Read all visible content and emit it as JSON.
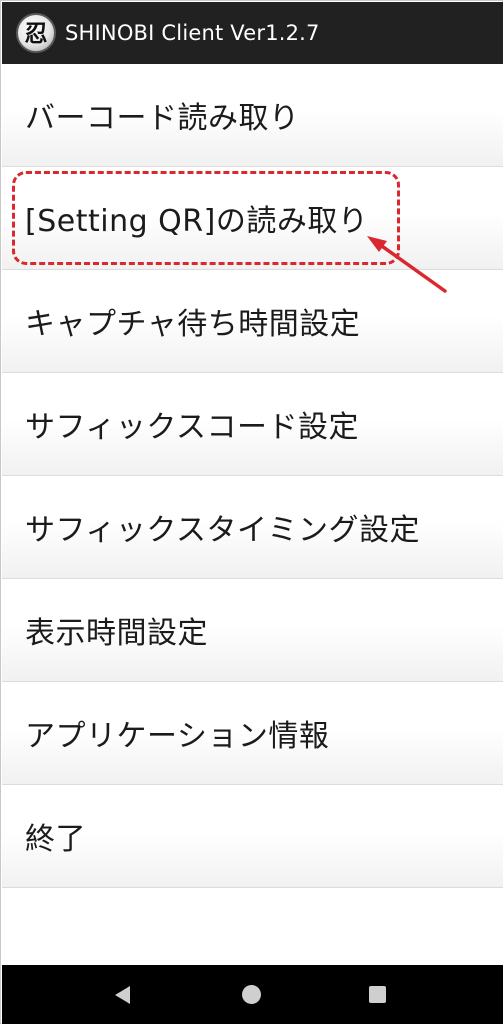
{
  "titlebar": {
    "icon_glyph": "忍",
    "icon_name": "shinobi-logo-icon",
    "title": "SHINOBI Client Ver1.2.7"
  },
  "menu": {
    "items": [
      {
        "label": "バーコード読み取り"
      },
      {
        "label": "[Setting QR]の読み取り"
      },
      {
        "label": "キャプチャ待ち時間設定"
      },
      {
        "label": "サフィックスコード設定"
      },
      {
        "label": "サフィックスタイミング設定"
      },
      {
        "label": "表示時間設定"
      },
      {
        "label": "アプリケーション情報"
      },
      {
        "label": "終了"
      }
    ]
  },
  "annotation": {
    "highlighted_item": "[Setting QR]の読み取り",
    "color": "#d9282f"
  },
  "navbar": {
    "back_icon": "back-triangle-icon",
    "home_icon": "home-circle-icon",
    "recents_icon": "recents-square-icon"
  },
  "colors": {
    "titlebar_bg": "#212121",
    "navbar_bg": "#000000",
    "menu_text": "#1b1b1b"
  }
}
